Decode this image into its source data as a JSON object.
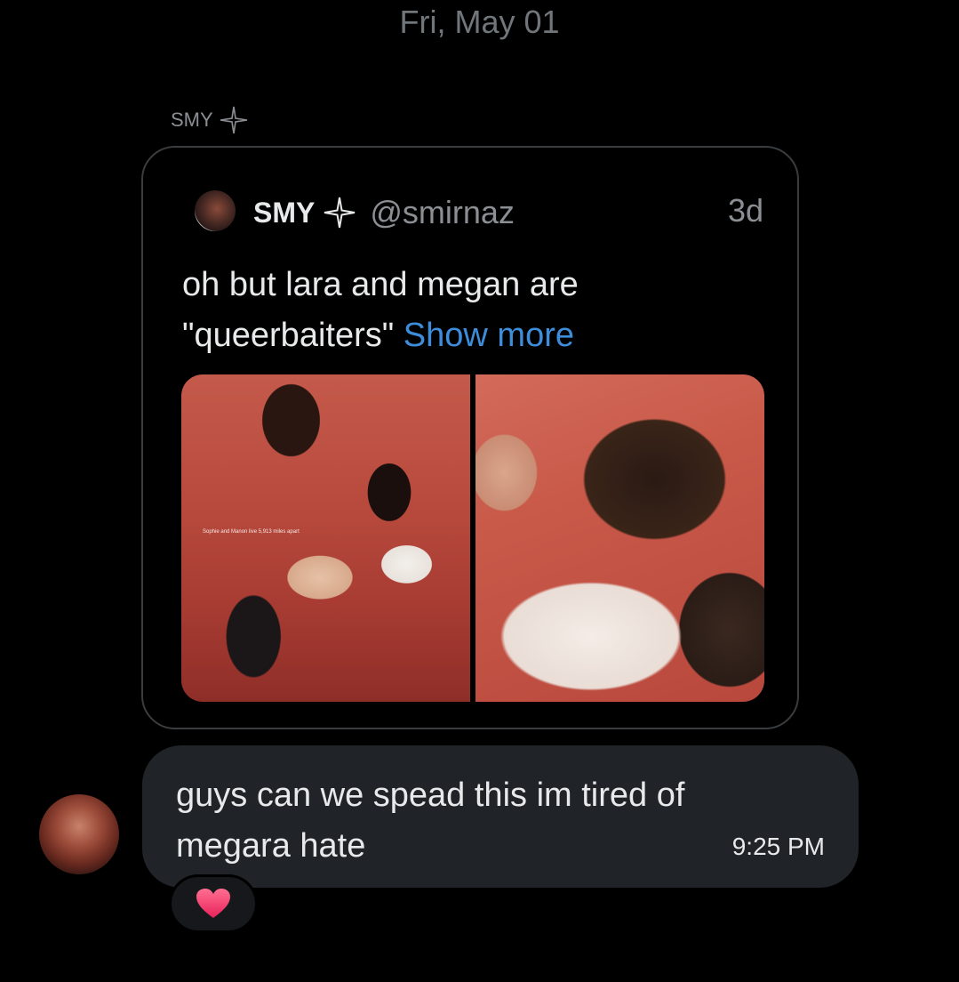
{
  "date_separator": "Fri, May 01",
  "sender": {
    "name": "SMY",
    "badge_icon": "sparkle-star-icon"
  },
  "quoted_post": {
    "author_name": "SMY",
    "badge_icon": "sparkle-star-icon",
    "handle": "@smirnaz",
    "time": "3d",
    "text_line1": "oh but lara and megan are",
    "text_line2": "\"queerbaiters\"",
    "show_more": "Show more",
    "photo_caption": "Sophie and Manon live 5,913 miles apart"
  },
  "message": {
    "text_line1": "guys can we spead this im tired of",
    "text_line2": "megara hate",
    "time": "9:25 PM",
    "reaction_icon": "heart-icon"
  },
  "colors": {
    "background": "#000000",
    "bubble": "#202327",
    "link": "#3e8ddb",
    "muted": "#71767b",
    "heart": "#f0346a"
  }
}
